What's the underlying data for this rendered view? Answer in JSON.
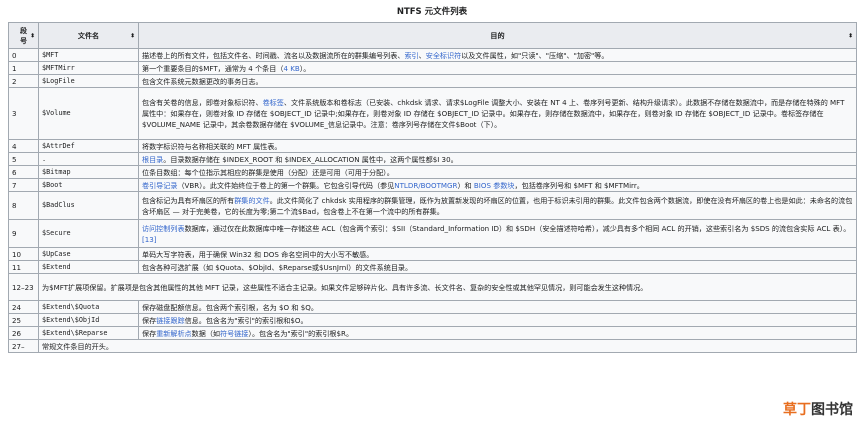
{
  "title": "NTFS 元文件列表",
  "headers": {
    "index": "段号",
    "filename": "文件名",
    "purpose": "目的",
    "sort_glyph": "⬍"
  },
  "rows": [
    {
      "idx": "0",
      "file": "$MFT",
      "segs": [
        {
          "t": "描述卷上的所有文件，包括文件名、时间戳、流名以及数据流所在的群集编号列表、"
        },
        {
          "t": "索引",
          "link": true
        },
        {
          "t": "、"
        },
        {
          "t": "安全标识符",
          "link": true
        },
        {
          "t": "以及文件属性，如\"只读\"、\"压缩\"、\"加密\"等。"
        }
      ]
    },
    {
      "idx": "1",
      "file": "$MFTMirr",
      "segs": [
        {
          "t": "第一个重要条目的$MFT，通常为 4 个条目（"
        },
        {
          "t": "4 KB",
          "link": true
        },
        {
          "t": "）。"
        }
      ]
    },
    {
      "idx": "2",
      "file": "$LogFile",
      "segs": [
        {
          "t": "包含文件系统元数据更改的事务日志。"
        }
      ]
    },
    {
      "idx": "3",
      "file": "$Volume",
      "segs": [
        {
          "t": "包含有关卷的信息，即卷对象标识符、"
        },
        {
          "t": "卷标签",
          "link": true
        },
        {
          "t": "、文件系统版本和卷标志（已安装、chkdsk 请求、请求$LogFile 调整大小、安装在 NT 4 上、卷序列号更新、结构升级请求）。此数据不存储在数据流中，而是存储在特殊的 MFT 属性中：如果存在，则卷对象 ID 存储在 $OBJECT_ID 记录中;如果存在，则卷对象 ID 存储在 $OBJECT_ID 记录中。如果存在，则存储在数据流中，如果存在，则卷对象 ID 存储在 $OBJECT_ID 记录中。卷标签存储在 $VOLUME_NAME 记录中，其余卷数据存储在 $VOLUME_信息记录中。注意：卷序列号存储在文件$Boot（下）。"
        }
      ]
    },
    {
      "idx": "4",
      "file": "$AttrDef",
      "segs": [
        {
          "t": "将数字标识符与名称相关联的 MFT 属性表。"
        }
      ]
    },
    {
      "idx": "5",
      "file": ".",
      "segs": [
        {
          "t": "根目录",
          "link": true
        },
        {
          "t": "。目录数据存储在 $INDEX_ROOT 和 $INDEX_ALLOCATION 属性中，这两个属性都$I 30。"
        }
      ]
    },
    {
      "idx": "6",
      "file": "$Bitmap",
      "segs": [
        {
          "t": "位条目数组：每个位指示其相应的群集是使用（分配）还是可用（可用于分配）。"
        }
      ]
    },
    {
      "idx": "7",
      "file": "$Boot",
      "segs": [
        {
          "t": "卷引导记录",
          "link": true
        },
        {
          "t": "（VBR）。此文件始终位于卷上的第一个群集。它包含引导代码（参见"
        },
        {
          "t": "NTLDR/BOOTMGR",
          "link": true
        },
        {
          "t": "）和 "
        },
        {
          "t": "BIOS 参数块",
          "link": true
        },
        {
          "t": "，包括卷序列号和 $MFT 和 $MFTMirr。"
        }
      ]
    },
    {
      "idx": "8",
      "file": "$BadClus",
      "segs": [
        {
          "t": "包含标记为具有坏扇区的所有"
        },
        {
          "t": "群集的文件",
          "link": true
        },
        {
          "t": "。此文件简化了 chkdsk 实用程序的群集管理，既作为放置新发现的坏扇区的位置，也用于标识未引用的群集。此文件包含两个数据流，即使在没有坏扇区的卷上也是如此：未命名的流包含坏扇区 — 对于完美卷，它的长度为零;第二个流$Bad，包含卷上不在第一个流中的所有群集。"
        }
      ]
    },
    {
      "idx": "9",
      "file": "$Secure",
      "segs": [
        {
          "t": "访问控制列表",
          "link": true
        },
        {
          "t": "数据库，通过仅在此数据库中唯一存储这些 ACL（包含两个索引：$SII（Standard_Information ID）和 $SDH（安全描述符哈希），减少具有多个相同 ACL 的开销，这些索引名为 $SDS 的流包含实际 ACL 表）。"
        },
        {
          "t": "[13]",
          "link": true
        }
      ]
    },
    {
      "idx": "10",
      "file": "$UpCase",
      "segs": [
        {
          "t": "单码大写字符表，用于确保 Win32 和 DOS 命名空间中的大小写不敏感。"
        }
      ]
    },
    {
      "idx": "11",
      "file": "$Extend",
      "segs": [
        {
          "t": "包含各种可选扩展（如 $Quota、$ObjId、$Reparse或$UsnJrnl）的文件系统目录。"
        }
      ]
    },
    {
      "idx": "12–23",
      "file": "",
      "span": true,
      "segs": [
        {
          "t": "为$MFT扩展项保留。扩展项是包含其他属性的其他 MFT 记录，这些属性不适合主记录。如果文件足够碎片化、具有许多流、长文件名、复杂的安全性或其他罕见情况，则可能会发生这种情况。"
        }
      ]
    },
    {
      "idx": "24",
      "file": "$Extend\\$Quota",
      "segs": [
        {
          "t": "保存磁盘配额信息。包含两个索引根，名为 $O 和 $Q。"
        }
      ]
    },
    {
      "idx": "25",
      "file": "$Extend\\$ObjId",
      "segs": [
        {
          "t": "保存"
        },
        {
          "t": "链接跟踪",
          "link": true
        },
        {
          "t": "信息。包含名为\"索引\"的索引根和$O。"
        }
      ]
    },
    {
      "idx": "26",
      "file": "$Extend\\$Reparse",
      "segs": [
        {
          "t": "保存"
        },
        {
          "t": "重新解析点",
          "link": true
        },
        {
          "t": "数据（如"
        },
        {
          "t": "符号链接",
          "link": true
        },
        {
          "t": "）。包含名为\"索引\"的索引根$R。"
        }
      ]
    },
    {
      "idx": "27–",
      "file": "",
      "span": true,
      "segs": [
        {
          "t": "常规文件条目的开头。"
        }
      ]
    }
  ],
  "watermark": {
    "a": "草丁",
    "b": "图书馆"
  }
}
